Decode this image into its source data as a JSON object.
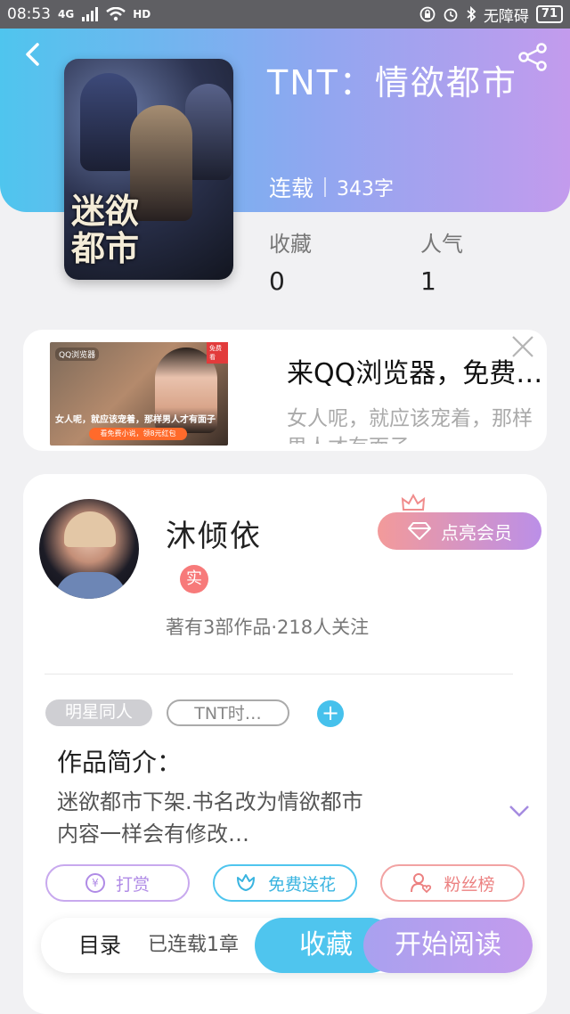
{
  "status_bar": {
    "time": "08:53",
    "network": "4G",
    "hd": "HD",
    "accessibility": "无障碍",
    "battery": "71"
  },
  "book": {
    "title": "TNT：情欲都市",
    "status": "连载",
    "word_count": "343字",
    "cover_title": "迷欲都市",
    "stats": {
      "collect_label": "收藏",
      "collect_value": "0",
      "popularity_label": "人气",
      "popularity_value": "1"
    }
  },
  "ad": {
    "title": "来QQ浏览器，免费看小说",
    "description": "女人呢，就应该宠着，那样男人才有面子",
    "image_caption": "女人呢，就应该宠着，那样男人才有面子",
    "image_pill": "看免费小说，领8元红包",
    "image_brand": "QQ浏览器",
    "image_corner": "免费看"
  },
  "author": {
    "name": "沐倾依",
    "verified_label": "实",
    "meta": "著有3部作品·218人关注",
    "vip_button": "点亮会员"
  },
  "tags": [
    "明星同人",
    "TNT时…"
  ],
  "intro": {
    "heading": "作品简介：",
    "text_line1": "迷欲都市下架.书名改为情欲都市",
    "text_line2": "内容一样会有修改…"
  },
  "actions": {
    "reward": "打赏",
    "flower": "免费送花",
    "fans": "粉丝榜"
  },
  "bottom_bar": {
    "catalog": "目录",
    "chapters": "已连载1章",
    "collect": "收藏",
    "read": "开始阅读"
  },
  "colors": {
    "accent_blue": "#4fc5ee",
    "accent_purple": "#c39bed",
    "badge_red": "#f77a7a"
  }
}
